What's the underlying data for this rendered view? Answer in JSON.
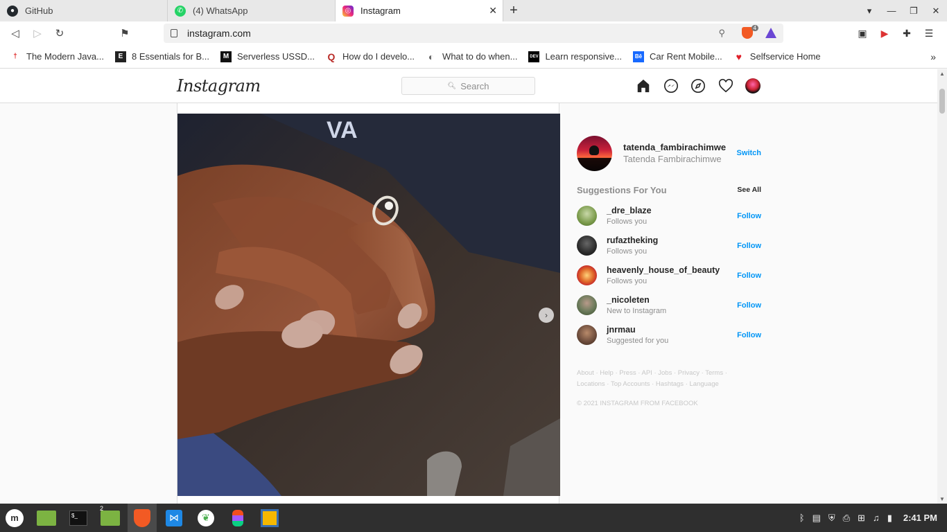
{
  "tabs": [
    {
      "label": "GitHub",
      "icon": "github-icon"
    },
    {
      "label": "(4) WhatsApp",
      "icon": "whatsapp-icon"
    },
    {
      "label": "Instagram",
      "icon": "instagram-icon",
      "active": true
    }
  ],
  "url": "instagram.com",
  "brave_badge": "4",
  "bookmarks": [
    {
      "label": "The Modern Java...",
      "icon_char": "†",
      "color": "#d22"
    },
    {
      "label": "8 Essentials for B...",
      "icon_char": "E",
      "color": "#222"
    },
    {
      "label": "Serverless USSD...",
      "icon_char": "M",
      "color": "#111"
    },
    {
      "label": "How do I develo...",
      "icon_char": "Q",
      "color": "#b92b27"
    },
    {
      "label": "What to do when...",
      "icon_char": "◐",
      "color": "#666"
    },
    {
      "label": "Learn responsive...",
      "icon_char": "DEV",
      "color": "#000"
    },
    {
      "label": "Car Rent Mobile...",
      "icon_char": "Bē",
      "color": "#1769ff"
    },
    {
      "label": "Selfservice Home",
      "icon_char": "♥",
      "color": "#e0202a"
    }
  ],
  "instagram": {
    "logo": "Instagram",
    "search_placeholder": "Search",
    "user": {
      "username": "tatenda_fambirachimwe",
      "full_name": "Tatenda Fambirachimwe",
      "switch_label": "Switch"
    },
    "suggestions_title": "Suggestions For You",
    "see_all_label": "See All",
    "suggestions": [
      {
        "username": "_dre_blaze",
        "subtitle": "Follows you",
        "action": "Follow",
        "avatar_color": "#7a9a4a"
      },
      {
        "username": "rufaztheking",
        "subtitle": "Follows you",
        "action": "Follow",
        "avatar_color": "#2a2a2a"
      },
      {
        "username": "heavenly_house_of_beauty",
        "subtitle": "Follows you",
        "action": "Follow",
        "avatar_color": "#c8302a"
      },
      {
        "username": "_nicoleten",
        "subtitle": "New to Instagram",
        "action": "Follow",
        "avatar_color": "#6a7a5a"
      },
      {
        "username": "jnrmau",
        "subtitle": "Suggested for you",
        "action": "Follow",
        "avatar_color": "#6a4a3a"
      }
    ],
    "footer_links": [
      "About",
      "Help",
      "Press",
      "API",
      "Jobs",
      "Privacy",
      "Terms",
      "Locations",
      "Top Accounts",
      "Hashtags",
      "Language"
    ],
    "copyright": "© 2021 INSTAGRAM FROM FACEBOOK"
  },
  "taskbar": {
    "clock": "2:41 PM",
    "workspace_badge": "2"
  }
}
